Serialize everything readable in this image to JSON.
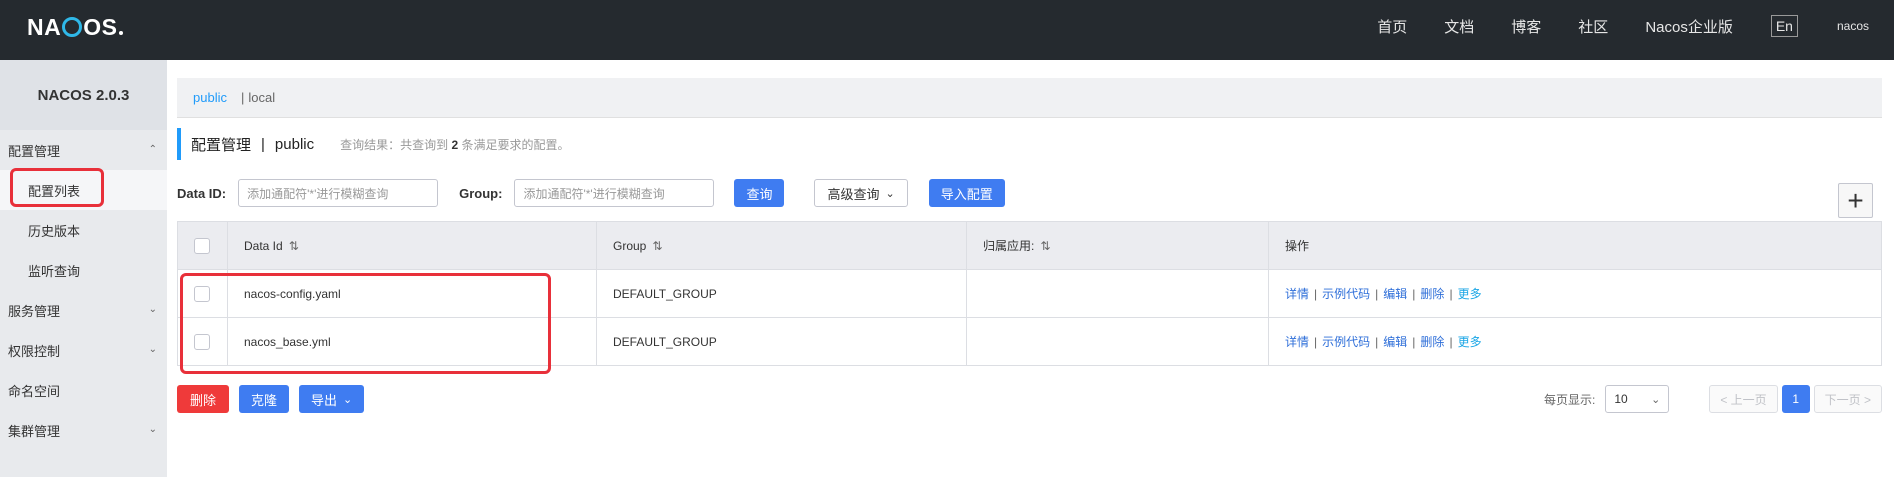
{
  "header": {
    "logo_text_a": "NA",
    "logo_text_b": "OS",
    "nav": [
      "首页",
      "文档",
      "博客",
      "社区",
      "Nacos企业版"
    ],
    "lang_button": "En",
    "username": "nacos"
  },
  "sidebar": {
    "version": "NACOS 2.0.3",
    "items": [
      {
        "label": "配置管理",
        "icon": "chevron-up-icon"
      },
      {
        "label": "配置列表"
      },
      {
        "label": "历史版本"
      },
      {
        "label": "监听查询"
      },
      {
        "label": "服务管理",
        "icon": "chevron-down-icon"
      },
      {
        "label": "权限控制",
        "icon": "chevron-down-icon"
      },
      {
        "label": "命名空间"
      },
      {
        "label": "集群管理",
        "icon": "chevron-down-icon"
      }
    ]
  },
  "namespace": {
    "active": "public",
    "separator": "|",
    "other": "local"
  },
  "page": {
    "title": "配置管理",
    "separator": "|",
    "namespace": "public",
    "hint_prefix": "查询结果：共查询到",
    "hint_count": "2",
    "hint_suffix": "条满足要求的配置。"
  },
  "filters": {
    "dataid_label": "Data ID:",
    "dataid_placeholder": "添加通配符'*'进行模糊查询",
    "group_label": "Group:",
    "group_placeholder": "添加通配符'*'进行模糊查询",
    "query_button": "查询",
    "advanced_button": "高级查询",
    "import_button": "导入配置",
    "add_button": "+"
  },
  "table": {
    "columns": [
      "Data Id",
      "Group",
      "归属应用:",
      "操作"
    ],
    "sort_icon": "⇅",
    "rows": [
      {
        "data_id": "nacos-config.yaml",
        "group": "DEFAULT_GROUP",
        "app": ""
      },
      {
        "data_id": "nacos_base.yml",
        "group": "DEFAULT_GROUP",
        "app": ""
      }
    ],
    "ops": [
      "详情",
      "示例代码",
      "编辑",
      "删除",
      "更多"
    ]
  },
  "bottom": {
    "delete_button": "删除",
    "clone_button": "克隆",
    "export_button": "导出"
  },
  "pager": {
    "per_page_label": "每页显示:",
    "per_page_value": "10",
    "prev": "< 上一页",
    "current": "1",
    "next": "下一页 >"
  },
  "colors": {
    "header_bg": "#252a2f",
    "accent_blue": "#3f7cf1",
    "danger_red": "#ef3a3a",
    "highlight_frame": "#e8303a"
  }
}
